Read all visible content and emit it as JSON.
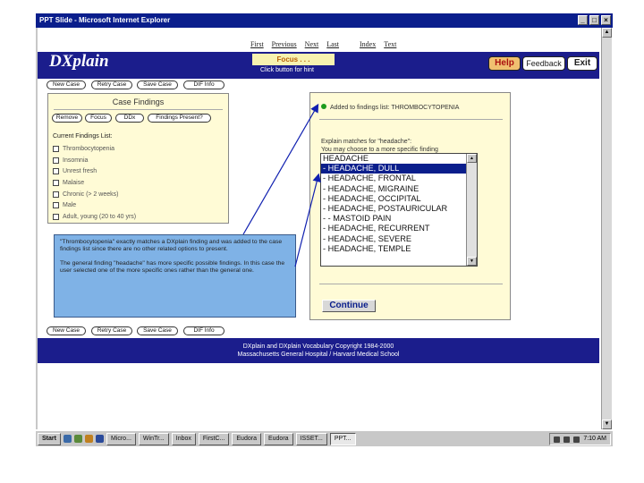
{
  "window": {
    "title": "PPT Slide - Microsoft Internet Explorer",
    "controls": [
      "_",
      "□",
      "×"
    ]
  },
  "topnav": [
    "First",
    "Previous",
    "Next",
    "Last",
    "Index",
    "Text"
  ],
  "header": {
    "logo": "DXplain",
    "focus": "Focus . . .",
    "click_hint": "Click button for hint",
    "help": "Help",
    "feedback": "Feedback",
    "exit": "Exit"
  },
  "toolbar": [
    "New Case",
    "Retry Case",
    "Save Case",
    "DIF Info"
  ],
  "case_findings": {
    "title": "Case Findings",
    "buttons": [
      "Remove",
      "Focus",
      "DDx",
      "Findings Present?"
    ],
    "list_title": "Current Findings List:",
    "items": [
      "Thrombocytopenia",
      "Insomnia",
      "Unrest fresh",
      "Malaise",
      "Chronic (> 2 weeks)",
      "Male",
      "Adult, young (20 to 40 yrs)"
    ]
  },
  "right_panel": {
    "added_text": "Added to findings list: THROMBOCYTOPENIA",
    "explain_line1": "Explain matches for \"headache\":",
    "explain_line2": "You may choose to a more specific finding",
    "options": [
      "HEADACHE",
      "- HEADACHE, DULL",
      "- HEADACHE, FRONTAL",
      "- HEADACHE, MIGRAINE",
      "- HEADACHE, OCCIPITAL",
      "- HEADACHE, POSTAURICULAR",
      "- - MASTOID PAIN",
      "- HEADACHE, RECURRENT",
      "- HEADACHE, SEVERE",
      "- HEADACHE, TEMPLE"
    ],
    "selected_index": 1,
    "continue": "Continue"
  },
  "note": {
    "para1": "\"Thrombocytopenia\" exactly matches a DXplain finding and was added to the case findings list since there are no other related options to present.",
    "para2": "The general finding \"headache\" has more specific possible findings. In this case the user selected one of the more specific ones rather than the general one."
  },
  "footer": {
    "line1": "DXplain and DXplain Vocabulary Copyright 1984-2000",
    "line2": "Massachusetts General Hospital / Harvard Medical School"
  },
  "taskbar": {
    "start": "Start",
    "items": [
      "Micro...",
      "WinTr...",
      "Inbox",
      "FirstC...",
      "Eudora",
      "Eudora",
      "ISSET...",
      "PPT..."
    ],
    "clock": "7:10 AM"
  }
}
